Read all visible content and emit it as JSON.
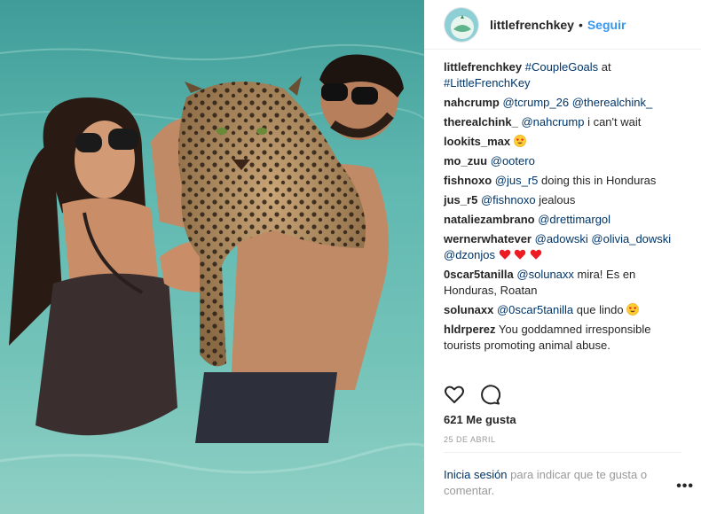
{
  "post": {
    "username": "littlefrenchkey",
    "separator": "•",
    "follow_label": "Seguir",
    "caption": {
      "user": "littlefrenchkey",
      "parts": [
        "#CoupleGoals",
        " at ",
        "#LittleFrenchKey"
      ]
    }
  },
  "comments": [
    {
      "user": "nahcrump",
      "mention": "@tcrump_26 @therealchink_",
      "text": ""
    },
    {
      "user": "therealchink_",
      "mention": "@nahcrump",
      "text": " i can't wait"
    },
    {
      "user": "lookits_max",
      "mention": "",
      "text": "",
      "emoji": "heart-eyes-emoji"
    },
    {
      "user": "mo_zuu",
      "mention": "@ootero",
      "text": ""
    },
    {
      "user": "fishnoxo",
      "mention": "@jus_r5",
      "text": " doing this in Honduras"
    },
    {
      "user": "jus_r5",
      "mention": "@fishnoxo",
      "text": " jealous"
    },
    {
      "user": "nataliezambrano",
      "mention": "@drettimargol",
      "text": ""
    },
    {
      "user": "wernerwhatever",
      "mention": "@adowski @olivia_dowski @dzonjos",
      "text": "",
      "emoji": "three-red-hearts-emoji"
    },
    {
      "user": "0scar5tanilla",
      "mention": "@solunaxx",
      "text": " mira! Es en Honduras, Roatan"
    },
    {
      "user": "solunaxx",
      "mention": "@0scar5tanilla",
      "text": " que lindo",
      "emoji": "heart-eyes-emoji"
    },
    {
      "user": "hldrperez",
      "mention": "",
      "text": "You goddamned irresponsible tourists promoting animal abuse."
    }
  ],
  "actions": {
    "like_icon": "heart-icon",
    "comment_icon": "comment-icon"
  },
  "likes": "621 Me gusta",
  "date": "25 DE ABRIL",
  "login": {
    "link": "Inicia sesión",
    "rest": " para indicar que te gusta o comentar."
  },
  "more_label": "•••",
  "colors": {
    "link": "#003569",
    "follow": "#3897f0",
    "muted": "#999999",
    "water": "#5fb3ad",
    "heart": "#ed1c24"
  }
}
